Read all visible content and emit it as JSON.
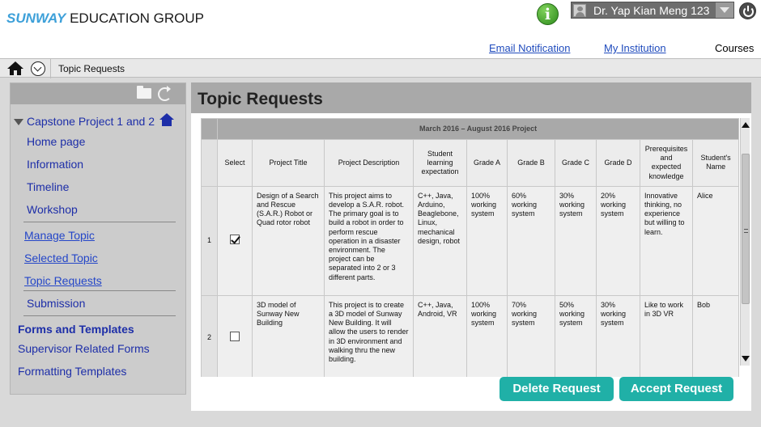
{
  "header": {
    "brand_primary": "SUNWAY",
    "brand_secondary": "EDUCATION GROUP",
    "user_name": "Dr. Yap Kian Meng 123",
    "links": [
      "Email Notification",
      "My Institution",
      "Courses"
    ]
  },
  "breadcrumb": {
    "current": "Topic Requests"
  },
  "sidebar": {
    "course": "Capstone Project 1 and 2",
    "course_items": [
      "Home page",
      "Information",
      "Timeline",
      "Workshop"
    ],
    "topic_items": [
      "Manage Topic",
      "Selected Topic",
      "Topic Requests"
    ],
    "submission": "Submission",
    "forms_heading": "Forms and Templates",
    "form_items": [
      "Supervisor Related Forms",
      "Formatting Templates"
    ]
  },
  "main": {
    "title": "Topic Requests",
    "table": {
      "period": "March 2016 – August 2016 Project",
      "columns": [
        "Select",
        "Project Title",
        "Project Description",
        "Student learning expectation",
        "Grade A",
        "Grade B",
        "Grade C",
        "Grade D",
        "Prerequisites and expected knowledge",
        "Student's Name"
      ],
      "rows": [
        {
          "index": "1",
          "selected": true,
          "title": "Design of a Search and Rescue (S.A.R.) Robot or Quad rotor robot",
          "description": "This project aims to develop a S.A.R. robot. The primary goal is to build a robot in order to perform rescue operation in a disaster environment. The project can be separated into 2 or 3 different parts.",
          "expectation": "C++, Java, Arduino, Beaglebone, Linux, mechanical design, robot",
          "grade_a": "100% working system",
          "grade_b": "60% working system",
          "grade_c": "30% working system",
          "grade_d": "20% working system",
          "prereq": "Innovative thinking, no experience but willing to learn.",
          "student": "Alice"
        },
        {
          "index": "2",
          "selected": false,
          "title": "3D model of Sunway New Building",
          "description": "This project is to create a 3D model of Sunway New Building. It will allow the users to render in 3D environment and walking thru the new building.",
          "expectation": "C++, Java, Android, VR",
          "grade_a": "100% working system",
          "grade_b": "70% working system",
          "grade_c": "50% working system",
          "grade_d": "30% working system",
          "prereq": "Like to work in 3D VR",
          "student": "Bob"
        }
      ]
    },
    "delete_label": "Delete Request",
    "accept_label": "Accept Request"
  },
  "colors": {
    "accent_button": "#20b0a7",
    "link": "#1f4bbd",
    "brand": "#3da0d9"
  }
}
